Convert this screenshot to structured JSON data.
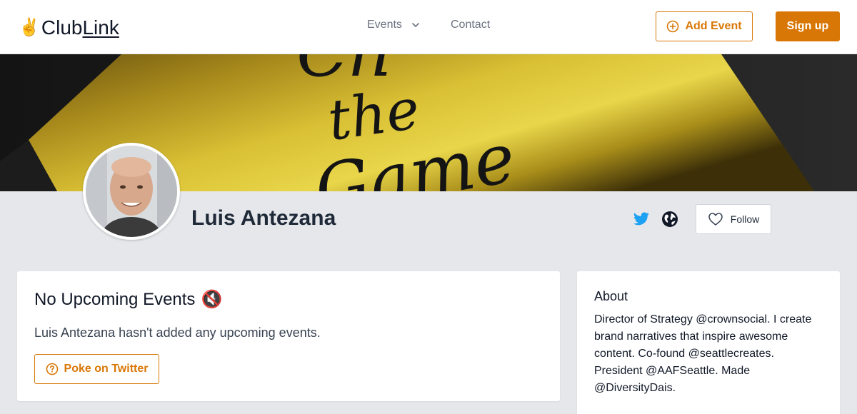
{
  "header": {
    "logo_emoji": "✌️",
    "logo_club": "Club",
    "logo_link": "Link",
    "nav_events": "Events",
    "nav_contact": "Contact",
    "add_event": "Add Event",
    "sign_up": "Sign up"
  },
  "cover": {
    "script_words": [
      "Ch",
      "the",
      "Game"
    ]
  },
  "profile": {
    "name": "Luis Antezana",
    "follow": "Follow"
  },
  "events_card": {
    "title": "No Upcoming Events",
    "title_emoji": "🔇",
    "empty_message": "Luis Antezana hasn't added any upcoming events.",
    "poke_button": "Poke on Twitter"
  },
  "about_card": {
    "title": "About",
    "text": "Director of Strategy @crownsocial. I create brand narratives that inspire awesome content. Co-found @seattlecreates. President @AAFSeattle. Made @DiversityDais."
  },
  "colors": {
    "accent": "#d97706",
    "twitter": "#1da1f2",
    "page_bg": "#e5e7eb"
  }
}
